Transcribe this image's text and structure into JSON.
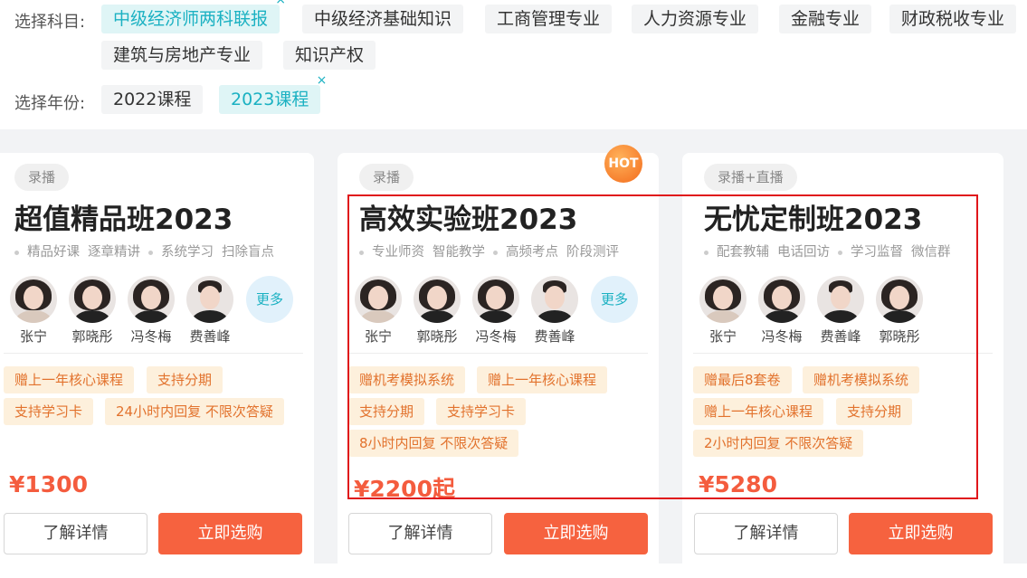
{
  "filters": {
    "subject_label": "选择科目:",
    "subjects": [
      {
        "label": "中级经济师两科联报",
        "active": true
      },
      {
        "label": "中级经济基础知识",
        "active": false
      },
      {
        "label": "工商管理专业",
        "active": false
      },
      {
        "label": "人力资源专业",
        "active": false
      },
      {
        "label": "金融专业",
        "active": false
      },
      {
        "label": "财政税收专业",
        "active": false
      },
      {
        "label": "建筑与房地产专业",
        "active": false
      },
      {
        "label": "知识产权",
        "active": false
      }
    ],
    "year_label": "选择年份:",
    "years": [
      {
        "label": "2022课程",
        "active": false
      },
      {
        "label": "2023课程",
        "active": true
      }
    ],
    "close_glyph": "×"
  },
  "cards": [
    {
      "type_tag": "录播",
      "title": "超值精品班2023",
      "features": [
        "精品好课",
        "逐章精讲",
        "系统学习",
        "扫除盲点"
      ],
      "teachers": [
        "张宁",
        "郭晓彤",
        "冯冬梅",
        "费善峰"
      ],
      "more_label": "更多",
      "perks": [
        "赠上一年核心课程",
        "支持分期",
        "支持学习卡",
        "24小时内回复 不限次答疑"
      ],
      "price": "¥1300",
      "detail_label": "了解详情",
      "buy_label": "立即选购"
    },
    {
      "type_tag": "录播",
      "hot_badge": "HOT",
      "title": "高效实验班2023",
      "features": [
        "专业师资",
        "智能教学",
        "高频考点",
        "阶段测评"
      ],
      "teachers": [
        "张宁",
        "郭晓彤",
        "冯冬梅",
        "费善峰"
      ],
      "more_label": "更多",
      "perks": [
        "赠机考模拟系统",
        "赠上一年核心课程",
        "支持分期",
        "支持学习卡",
        "8小时内回复 不限次答疑"
      ],
      "price": "¥2200起",
      "detail_label": "了解详情",
      "buy_label": "立即选购"
    },
    {
      "type_tag": "录播+直播",
      "title": "无忧定制班2023",
      "features": [
        "配套教辅",
        "电话回访",
        "学习监督",
        "微信群"
      ],
      "teachers": [
        "张宁",
        "冯冬梅",
        "费善峰",
        "郭晓彤"
      ],
      "perks": [
        "赠最后8套卷",
        "赠机考模拟系统",
        "赠上一年核心课程",
        "支持分期",
        "2小时内回复 不限次答疑"
      ],
      "price": "¥5280",
      "detail_label": "了解详情",
      "buy_label": "立即选购"
    }
  ]
}
